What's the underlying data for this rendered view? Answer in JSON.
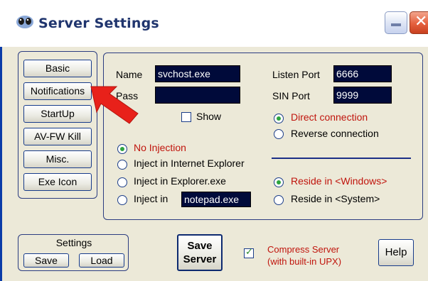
{
  "window": {
    "title": "Server Settings",
    "title_icon": "alien-icon"
  },
  "tabs": [
    "Basic",
    "Notifications",
    "StartUp",
    "AV-FW Kill",
    "Misc.",
    "Exe Icon"
  ],
  "basic": {
    "name_label": "Name",
    "name_value": "svchost.exe",
    "pass_label": "Pass",
    "pass_value": "",
    "show_label": "Show",
    "listen_port_label": "Listen Port",
    "listen_port_value": "6666",
    "sin_port_label": "SIN Port",
    "sin_port_value": "9999",
    "connection": {
      "direct_label": "Direct connection",
      "reverse_label": "Reverse connection",
      "selected": "Direct connection"
    },
    "injection": {
      "no_injection_label": "No Injection",
      "ie_label": "Inject in Internet Explorer",
      "explorer_label": "Inject in Explorer.exe",
      "inject_in_label": "Inject in",
      "inject_in_value": "notepad.exe",
      "selected": "No Injection"
    },
    "reside": {
      "windows_label": "Reside in <Windows>",
      "system_label": "Reside in <System>",
      "selected": "Reside in <Windows>"
    }
  },
  "settings_group": {
    "title": "Settings",
    "save_label": "Save",
    "load_label": "Load"
  },
  "save_server": {
    "line1": "Save",
    "line2": "Server"
  },
  "compress": {
    "checked": true,
    "line1": "Compress Server",
    "line2": "(with built-in UPX)"
  },
  "help_label": "Help",
  "colors": {
    "field_bg": "#000a3a",
    "highlight_text": "#c0140c",
    "arrow": "#e8211a",
    "title_text": "#20356e"
  }
}
